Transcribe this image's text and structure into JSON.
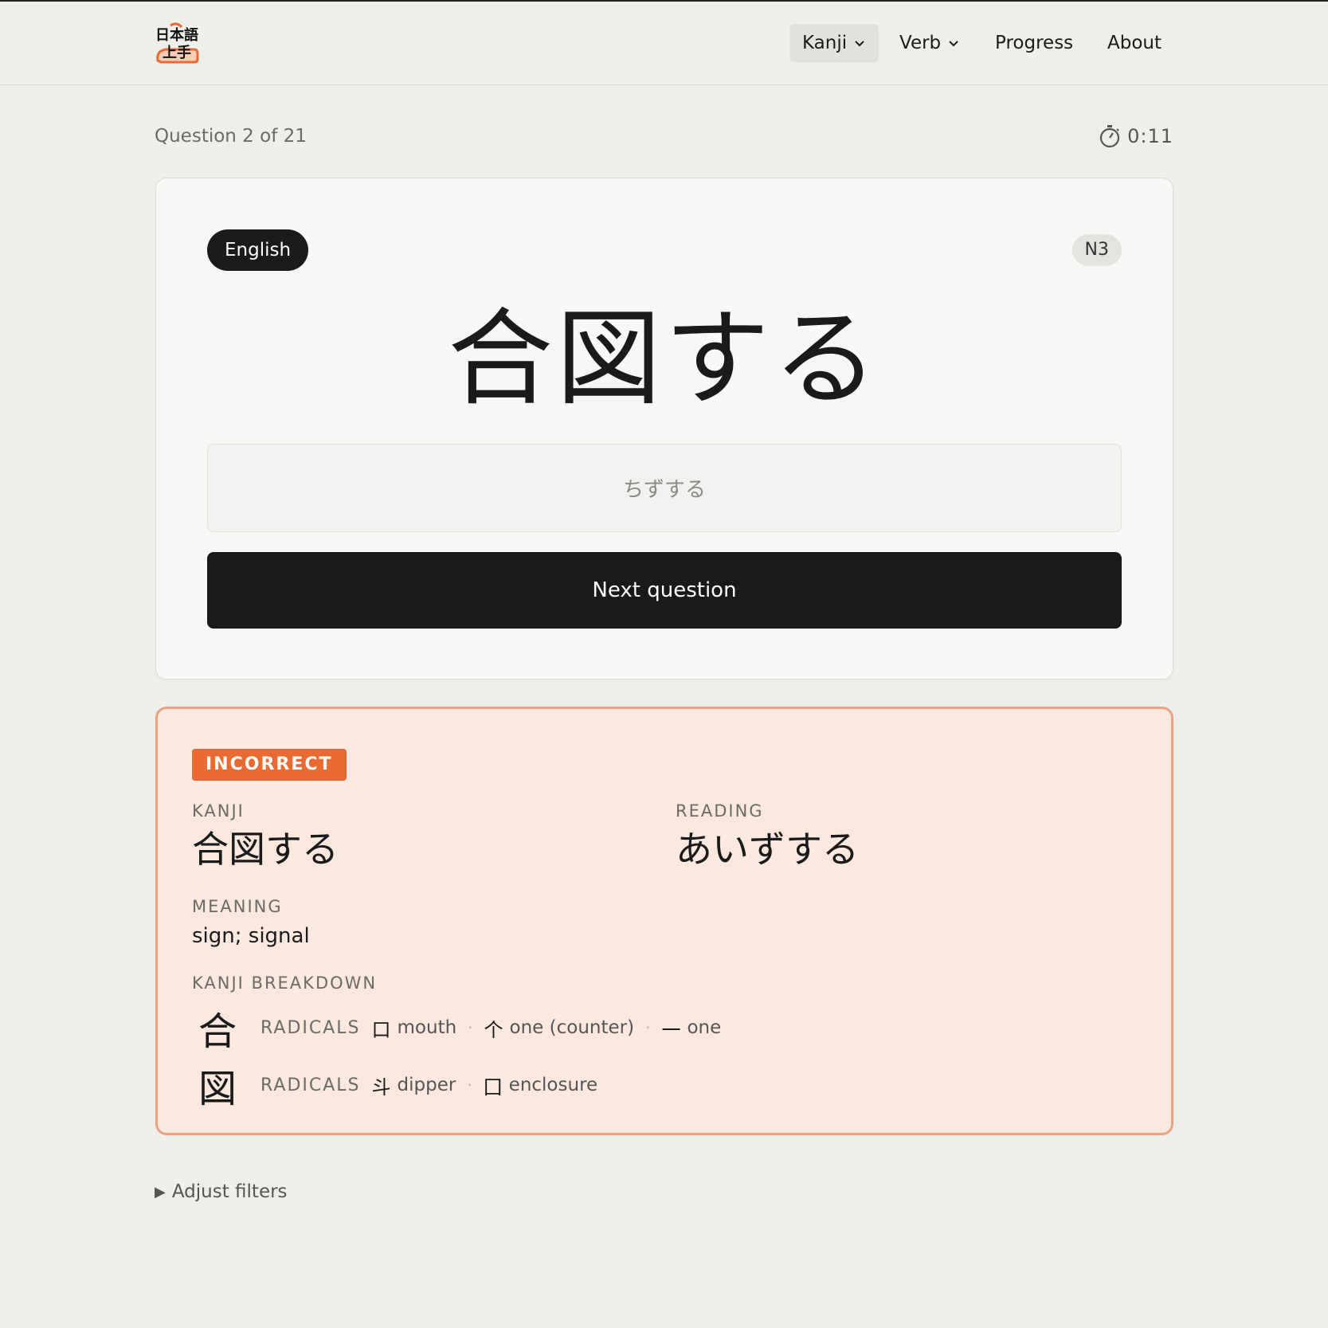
{
  "header": {
    "logo_text_top": "日本語",
    "logo_text_bottom": "上手",
    "nav": [
      {
        "label": "Kanji",
        "dropdown": true,
        "active": true
      },
      {
        "label": "Verb",
        "dropdown": true,
        "active": false
      },
      {
        "label": "Progress",
        "dropdown": false,
        "active": false
      },
      {
        "label": "About",
        "dropdown": false,
        "active": false
      }
    ]
  },
  "quiz": {
    "counter": "Question 2 of 21",
    "timer": "0:11",
    "timer_icon": "stopwatch-icon"
  },
  "card": {
    "mode_pill": "English",
    "level_pill": "N3",
    "prompt": "合図する",
    "answer_value": "ちずする",
    "next_label": "Next question"
  },
  "result": {
    "status": "INCORRECT",
    "kanji_label": "KANJI",
    "kanji_value": "合図する",
    "reading_label": "READING",
    "reading_value": "あいずする",
    "meaning_label": "MEANING",
    "meaning_value": "sign; signal",
    "breakdown_label": "KANJI BREAKDOWN",
    "breakdown": [
      {
        "kanji": "合",
        "radicals_label": "RADICALS",
        "radicals": [
          {
            "glyph": "口",
            "meaning": "mouth"
          },
          {
            "glyph": "个",
            "meaning": "one (counter)"
          },
          {
            "glyph": "一",
            "meaning": "one"
          }
        ]
      },
      {
        "kanji": "図",
        "radicals_label": "RADICALS",
        "radicals": [
          {
            "glyph": "斗",
            "meaning": "dipper"
          },
          {
            "glyph": "囗",
            "meaning": "enclosure"
          }
        ]
      }
    ]
  },
  "filters": {
    "label": "Adjust filters"
  },
  "colors": {
    "background": "#efefea",
    "accent_dark": "#1a1a1a",
    "incorrect_bg": "#fbe8df",
    "incorrect_border": "#eda282",
    "incorrect_badge": "#e96a32"
  }
}
